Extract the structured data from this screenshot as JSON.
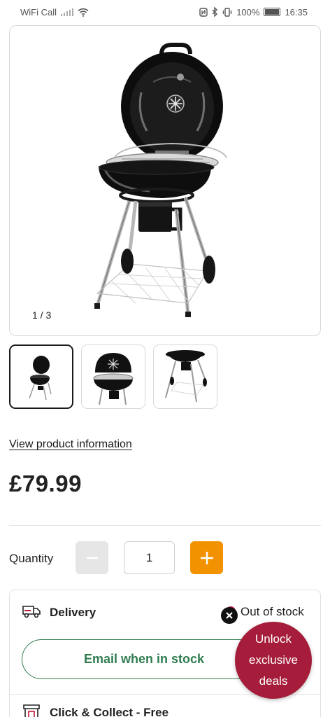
{
  "status_bar": {
    "carrier": "WiFi Call",
    "battery": "100%",
    "time": "16:35"
  },
  "gallery": {
    "counter": "1 / 3",
    "thumbnails": [
      {
        "name": "thumbnail-1",
        "active": true
      },
      {
        "name": "thumbnail-2",
        "active": false
      },
      {
        "name": "thumbnail-3",
        "active": false
      }
    ]
  },
  "product": {
    "view_info_link": "View product information",
    "price": "£79.99"
  },
  "quantity": {
    "label": "Quantity",
    "value": "1",
    "minus_icon": "minus-icon",
    "plus_icon": "plus-icon"
  },
  "delivery": {
    "title": "Delivery",
    "stock_status": "Out of stock",
    "email_button": "Email when in stock",
    "collect_title": "Click & Collect - Free"
  },
  "deals": {
    "line1": "Unlock",
    "line2": "exclusive",
    "line3": "deals"
  },
  "colors": {
    "accent_orange": "#f39200",
    "brand_green": "#2f7d4f",
    "deals_red": "#a51d3a",
    "stock_red": "#c4173a"
  }
}
